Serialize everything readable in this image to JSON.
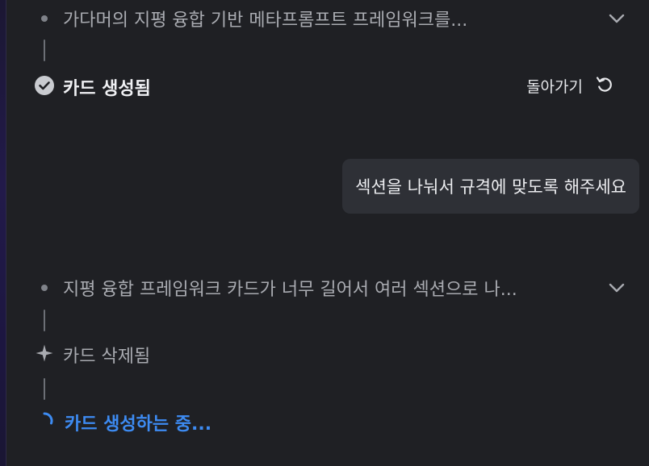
{
  "steps": {
    "step1": {
      "text": "가다머의 지평 융합 기반 메타프롬프트 프레임워크를..."
    },
    "card_created": {
      "label": "카드 생성됨",
      "back_label": "돌아가기"
    },
    "user_message": {
      "text": "섹션을 나눠서 규격에 맞도록 해주세요"
    },
    "step2": {
      "text": "지평 융합 프레임워크 카드가 너무 길어서 여러 섹션으로 나..."
    },
    "card_deleted": {
      "label": "카드 삭제됨"
    },
    "card_generating": {
      "label": "카드 생성하는 중..."
    }
  },
  "icons": {
    "bullet": "dot-icon",
    "expand": "chevron-down-icon",
    "done": "check-circle-icon",
    "undo": "undo-icon",
    "deleted": "sparkle-icon",
    "loading": "spinner-icon"
  },
  "colors": {
    "background": "#1f2024",
    "bubble": "#2e3036",
    "accent": "#3d8bf2"
  }
}
